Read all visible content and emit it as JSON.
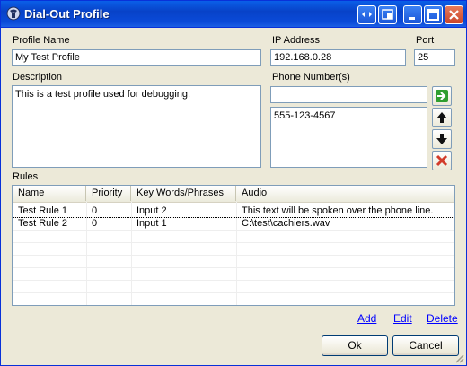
{
  "window": {
    "title": "Dial-Out Profile"
  },
  "form": {
    "profile_name_label": "Profile Name",
    "profile_name_value": "My Test Profile",
    "ip_label": "IP Address",
    "ip_value": "192.168.0.28",
    "port_label": "Port",
    "port_value": "25",
    "description_label": "Description",
    "description_value": "This is a test profile used for debugging.",
    "phone_label": "Phone Number(s)",
    "phone_input_value": "",
    "phone_numbers": [
      "555-123-4567"
    ]
  },
  "rules": {
    "label": "Rules",
    "columns": [
      "Name",
      "Priority",
      "Key Words/Phrases",
      "Audio"
    ],
    "rows": [
      {
        "name": "Test Rule 1",
        "priority": "0",
        "keywords": "Input 2",
        "audio": "This text will be spoken over the phone line."
      },
      {
        "name": "Test Rule 2",
        "priority": "0",
        "keywords": "Input 1",
        "audio": "C:\\test\\cachiers.wav"
      }
    ],
    "add_label": "Add",
    "edit_label": "Edit",
    "delete_label": "Delete"
  },
  "buttons": {
    "ok_label": "Ok",
    "cancel_label": "Cancel"
  },
  "icons": [
    "app-icon",
    "restore-icon",
    "pin-icon",
    "minimize-icon",
    "maximize-icon",
    "close-icon",
    "add-arrow-icon",
    "move-up-icon",
    "move-down-icon",
    "delete-x-icon",
    "resize-grip-icon"
  ],
  "colors": {
    "titlebar": "#0842c8",
    "link": "#0000ff",
    "delete_icon": "#d23b2a",
    "add_icon": "#2f9e2f"
  }
}
